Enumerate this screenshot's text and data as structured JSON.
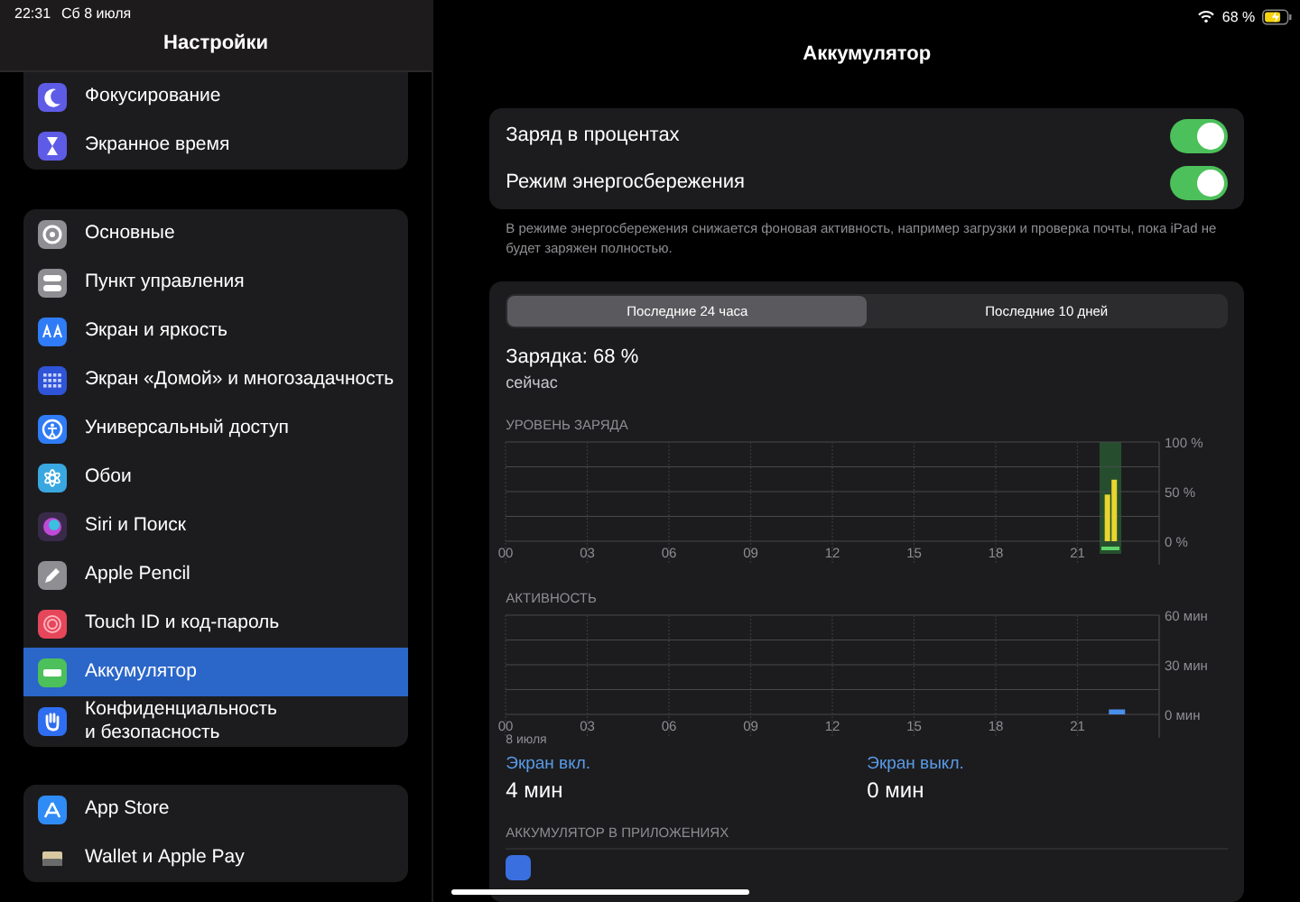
{
  "status_bar": {
    "time": "22:31",
    "date": "Сб 8 июля",
    "battery": "68 %"
  },
  "sidebar": {
    "title": "Настройки",
    "groups": [
      {
        "items": [
          {
            "label": "Фокусирование",
            "selected": false
          },
          {
            "label": "Экранное время",
            "selected": false
          }
        ]
      },
      {
        "items": [
          {
            "label": "Основные",
            "selected": false
          },
          {
            "label": "Пункт управления",
            "selected": false
          },
          {
            "label": "Экран и яркость",
            "selected": false
          },
          {
            "label": "Экран «Домой» и многозадачность",
            "selected": false
          },
          {
            "label": "Универсальный доступ",
            "selected": false
          },
          {
            "label": "Обои",
            "selected": false
          },
          {
            "label": "Siri и Поиск",
            "selected": false
          },
          {
            "label": "Apple Pencil",
            "selected": false
          },
          {
            "label": "Touch ID и код-пароль",
            "selected": false
          },
          {
            "label": "Аккумулятор",
            "selected": true
          },
          {
            "label": "Конфиденциальность\nи безопасность",
            "selected": false
          }
        ]
      },
      {
        "items": [
          {
            "label": "App Store",
            "selected": false
          },
          {
            "label": "Wallet и Apple Pay",
            "selected": false
          }
        ]
      }
    ]
  },
  "detail": {
    "title": "Аккумулятор",
    "toggles": [
      {
        "label": "Заряд в процентах",
        "on": true
      },
      {
        "label": "Режим энергосбережения",
        "on": true
      }
    ],
    "footnote": "В режиме энергосбережения снижается фоновая активность, например загрузки и проверка почты, пока iPad не будет заряжен полностью.",
    "segments": [
      {
        "label": "Последние 24 часа",
        "selected": true
      },
      {
        "label": "Последние 10 дней",
        "selected": false
      }
    ],
    "charge": "Зарядка: 68 %",
    "charge_time": "сейчас",
    "battery_level": {
      "title": "УРОВЕНЬ ЗАРЯДА",
      "chart_data": {
        "type": "bar",
        "x": [
          22.1,
          22.35
        ],
        "values": [
          47,
          62
        ],
        "xlim": [
          0,
          24
        ],
        "ylim": [
          0,
          100
        ],
        "xticks": [
          {
            "value": 0,
            "label": "00"
          },
          {
            "value": 3,
            "label": "03"
          },
          {
            "value": 6,
            "label": "06"
          },
          {
            "value": 9,
            "label": "09"
          },
          {
            "value": 12,
            "label": "12"
          },
          {
            "value": 15,
            "label": "15"
          },
          {
            "value": 18,
            "label": "18"
          },
          {
            "value": 21,
            "label": "21"
          }
        ],
        "yticks": [
          {
            "value": 0,
            "label": "0 %"
          },
          {
            "value": 50,
            "label": "50 %"
          },
          {
            "value": 100,
            "label": "100 %"
          }
        ],
        "grid": true,
        "ref_lines": [
          {
            "axis": "y",
            "value": 25
          },
          {
            "axis": "y",
            "value": 50
          },
          {
            "axis": "y",
            "value": 75
          }
        ]
      },
      "charging": true
    },
    "activity": {
      "title": "АКТИВНОСТЬ",
      "chart_data": {
        "type": "bar",
        "x": [
          22.45
        ],
        "values": [
          3
        ],
        "xlim": [
          0,
          24
        ],
        "ylim": [
          0,
          60
        ],
        "xticks": [
          {
            "value": 0,
            "label": "00"
          },
          {
            "value": 3,
            "label": "03"
          },
          {
            "value": 6,
            "label": "06"
          },
          {
            "value": 9,
            "label": "09"
          },
          {
            "value": 12,
            "label": "12"
          },
          {
            "value": 15,
            "label": "15"
          },
          {
            "value": 18,
            "label": "18"
          },
          {
            "value": 21,
            "label": "21"
          }
        ],
        "yticks": [
          {
            "value": 0,
            "label": "0 мин"
          },
          {
            "value": 30,
            "label": "30 мин"
          },
          {
            "value": 60,
            "label": "60 мин"
          }
        ],
        "grid": true,
        "ref_lines": [
          {
            "axis": "y",
            "value": 15
          },
          {
            "axis": "y",
            "value": 30
          },
          {
            "axis": "y",
            "value": 45
          }
        ]
      },
      "date": "8 июля"
    },
    "screen_stats": [
      {
        "label": "Экран вкл.",
        "value": "4 мин"
      },
      {
        "label": "Экран выкл.",
        "value": "0 мин"
      }
    ],
    "apps_header": "АККУМУЛЯТОР В ПРИЛОЖЕНИЯХ"
  }
}
